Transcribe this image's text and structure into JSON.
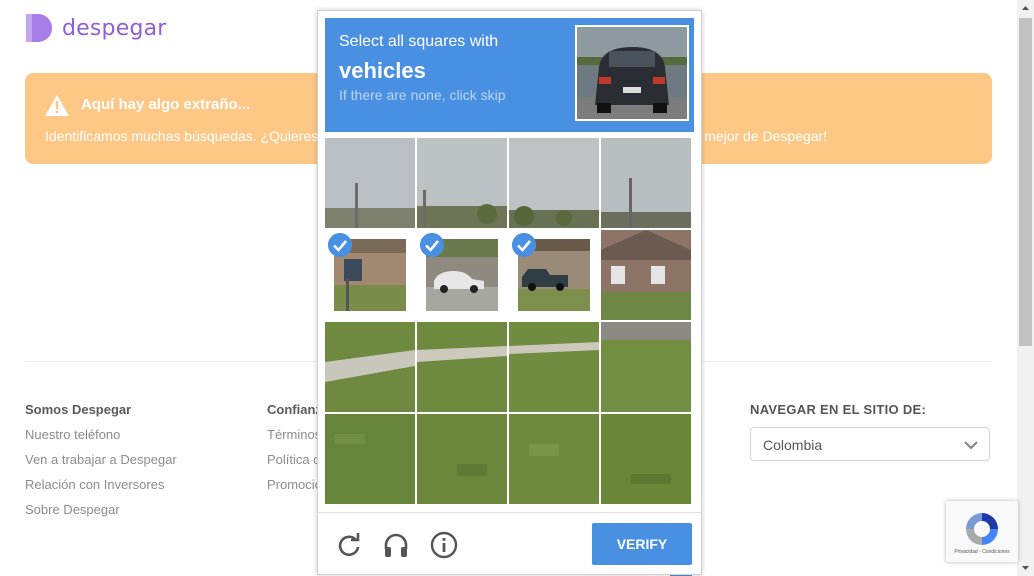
{
  "brand": {
    "name": "despegar",
    "color": "#8e5fd6"
  },
  "alert": {
    "title": "Aquí hay algo extraño...",
    "body": "Identificamos muchas búsquedas. ¿Quieres continuar? ¡Resuelve el captcha para que puedas disfrutar lo mejor de Despegar!",
    "color": "#fdc886"
  },
  "footer": {
    "col1": {
      "heading": "Somos Despegar",
      "links": [
        "Nuestro teléfono",
        "Ven a trabajar a Despegar",
        "Relación con Inversores",
        "Sobre Despegar"
      ]
    },
    "col2": {
      "heading": "Confianza",
      "links": [
        "Términos",
        "Política de privacidad",
        "Promociones"
      ]
    },
    "col3": {
      "heading": "NAVEGAR EN EL SITIO DE:",
      "selected_country": "Colombia"
    }
  },
  "captcha": {
    "instruction": "Select all squares with",
    "keyword": "vehicles",
    "hint": "If there are none, click skip",
    "accent": "#4a90e2",
    "selected_tiles": [
      5,
      6,
      7
    ],
    "verify_label": "VERIFY",
    "icons": [
      "reload-icon",
      "audio-icon",
      "info-icon"
    ]
  },
  "recaptcha_badge": {
    "text": "Privacidad - Condiciones"
  }
}
